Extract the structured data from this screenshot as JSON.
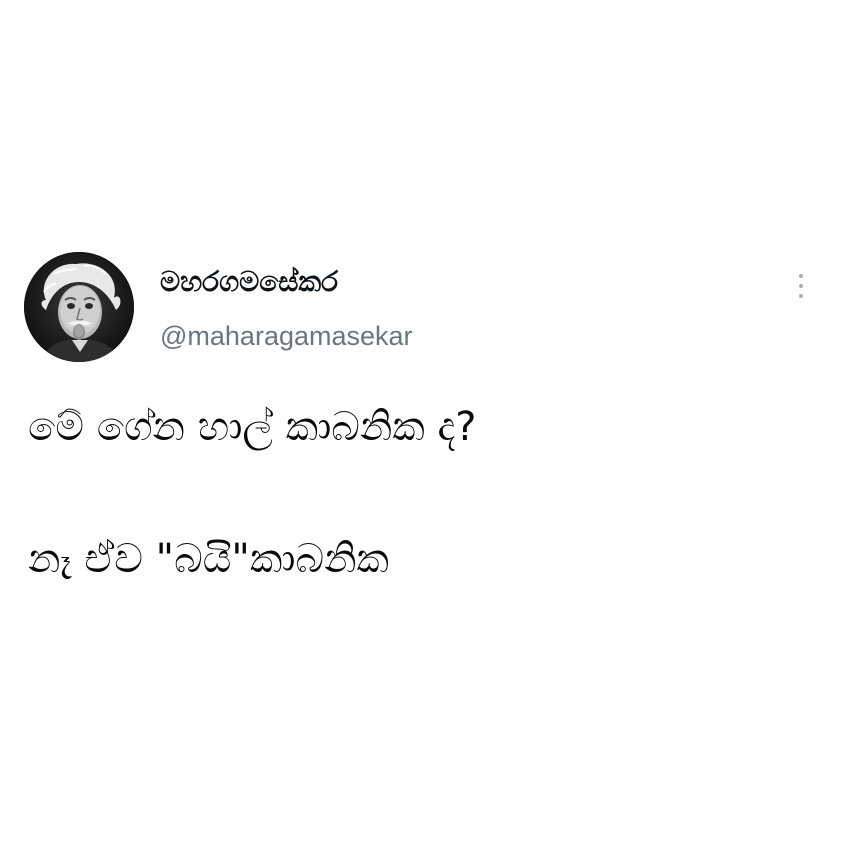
{
  "tweet": {
    "author": {
      "display_name": "මහරගමසේකර",
      "handle": "@maharagamasekar",
      "avatar": "profile-photo"
    },
    "more_icon": "more-vertical-icon",
    "body": {
      "line_1": "මේ ගේන හාල් කාබනික ද?",
      "line_2": "නෑ ඒව \"බයි\"කාබනික"
    }
  },
  "colors": {
    "text": "#0f1419",
    "handle": "#6a7680",
    "more_dots": "#a7b1b9",
    "background": "#ffffff"
  }
}
